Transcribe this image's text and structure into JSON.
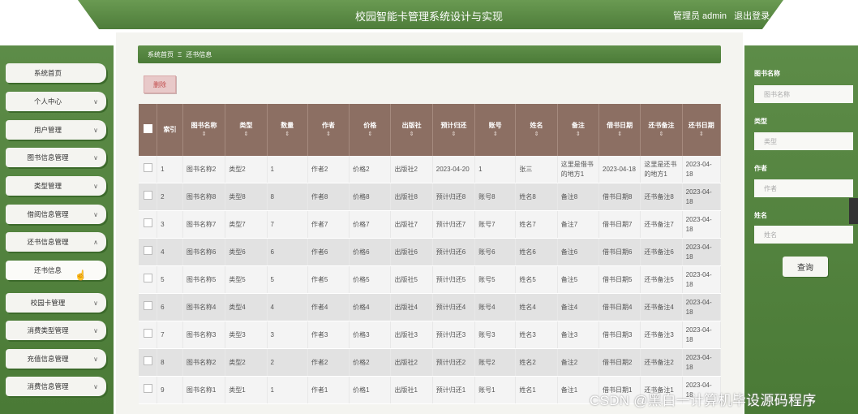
{
  "header": {
    "title": "校园智能卡管理系统设计与实现",
    "user_label": "管理员 admin",
    "logout_label": "退出登录"
  },
  "sidebar": {
    "items": [
      {
        "label": "系统首页",
        "chevron": ""
      },
      {
        "label": "个人中心",
        "chevron": "∨"
      },
      {
        "label": "用户管理",
        "chevron": "∨"
      },
      {
        "label": "图书信息管理",
        "chevron": "∨"
      },
      {
        "label": "类型管理",
        "chevron": "∨"
      },
      {
        "label": "借阅信息管理",
        "chevron": "∨"
      },
      {
        "label": "还书信息管理",
        "chevron": "∧"
      },
      {
        "label": "还书信息",
        "chevron": ""
      },
      {
        "label": "校园卡管理",
        "chevron": "∨"
      },
      {
        "label": "消费类型管理",
        "chevron": "∨"
      },
      {
        "label": "充值信息管理",
        "chevron": "∨"
      },
      {
        "label": "消费信息管理",
        "chevron": "∨"
      }
    ]
  },
  "breadcrumb": {
    "home": "系统首页",
    "separator": "Ξ",
    "current": "还书信息"
  },
  "toolbar": {
    "delete_label": "删除"
  },
  "table": {
    "sort_glyph": "⇕",
    "headers": [
      "索引",
      "图书名称",
      "类型",
      "数量",
      "作者",
      "价格",
      "出版社",
      "预计归还",
      "账号",
      "姓名",
      "备注",
      "借书日期",
      "还书备注",
      "还书日期"
    ],
    "rows": [
      [
        "1",
        "图书名称2",
        "类型2",
        "1",
        "作者2",
        "价格2",
        "出版社2",
        "2023-04-20",
        "1",
        "张三",
        "这里是借书的地方1",
        "2023-04-18",
        "这里是还书的地方1",
        "2023-04-18"
      ],
      [
        "2",
        "图书名称8",
        "类型8",
        "8",
        "作者8",
        "价格8",
        "出版社8",
        "预计归还8",
        "账号8",
        "姓名8",
        "备注8",
        "借书日期8",
        "还书备注8",
        "2023-04-18"
      ],
      [
        "3",
        "图书名称7",
        "类型7",
        "7",
        "作者7",
        "价格7",
        "出版社7",
        "预计归还7",
        "账号7",
        "姓名7",
        "备注7",
        "借书日期7",
        "还书备注7",
        "2023-04-18"
      ],
      [
        "4",
        "图书名称6",
        "类型6",
        "6",
        "作者6",
        "价格6",
        "出版社6",
        "预计归还6",
        "账号6",
        "姓名6",
        "备注6",
        "借书日期6",
        "还书备注6",
        "2023-04-18"
      ],
      [
        "5",
        "图书名称5",
        "类型5",
        "5",
        "作者5",
        "价格5",
        "出版社5",
        "预计归还5",
        "账号5",
        "姓名5",
        "备注5",
        "借书日期5",
        "还书备注5",
        "2023-04-18"
      ],
      [
        "6",
        "图书名称4",
        "类型4",
        "4",
        "作者4",
        "价格4",
        "出版社4",
        "预计归还4",
        "账号4",
        "姓名4",
        "备注4",
        "借书日期4",
        "还书备注4",
        "2023-04-18"
      ],
      [
        "7",
        "图书名称3",
        "类型3",
        "3",
        "作者3",
        "价格3",
        "出版社3",
        "预计归还3",
        "账号3",
        "姓名3",
        "备注3",
        "借书日期3",
        "还书备注3",
        "2023-04-18"
      ],
      [
        "8",
        "图书名称2",
        "类型2",
        "2",
        "作者2",
        "价格2",
        "出版社2",
        "预计归还2",
        "账号2",
        "姓名2",
        "备注2",
        "借书日期2",
        "还书备注2",
        "2023-04-18"
      ],
      [
        "9",
        "图书名称1",
        "类型1",
        "1",
        "作者1",
        "价格1",
        "出版社1",
        "预计归还1",
        "账号1",
        "姓名1",
        "备注1",
        "借书日期1",
        "还书备注1",
        "2023-04-18"
      ]
    ]
  },
  "search": {
    "book_name_label": "图书名称",
    "book_name_placeholder": "图书名称",
    "type_label": "类型",
    "type_placeholder": "类型",
    "author_label": "作者",
    "author_placeholder": "作者",
    "name_label": "姓名",
    "name_placeholder": "姓名",
    "query_label": "查询"
  },
  "watermark": "CSDN @黑白一计算机毕设源码程序",
  "colors": {
    "brand_green": "#4e7d3a",
    "table_header": "#8c6f63",
    "delete_text": "#c24b4b"
  }
}
